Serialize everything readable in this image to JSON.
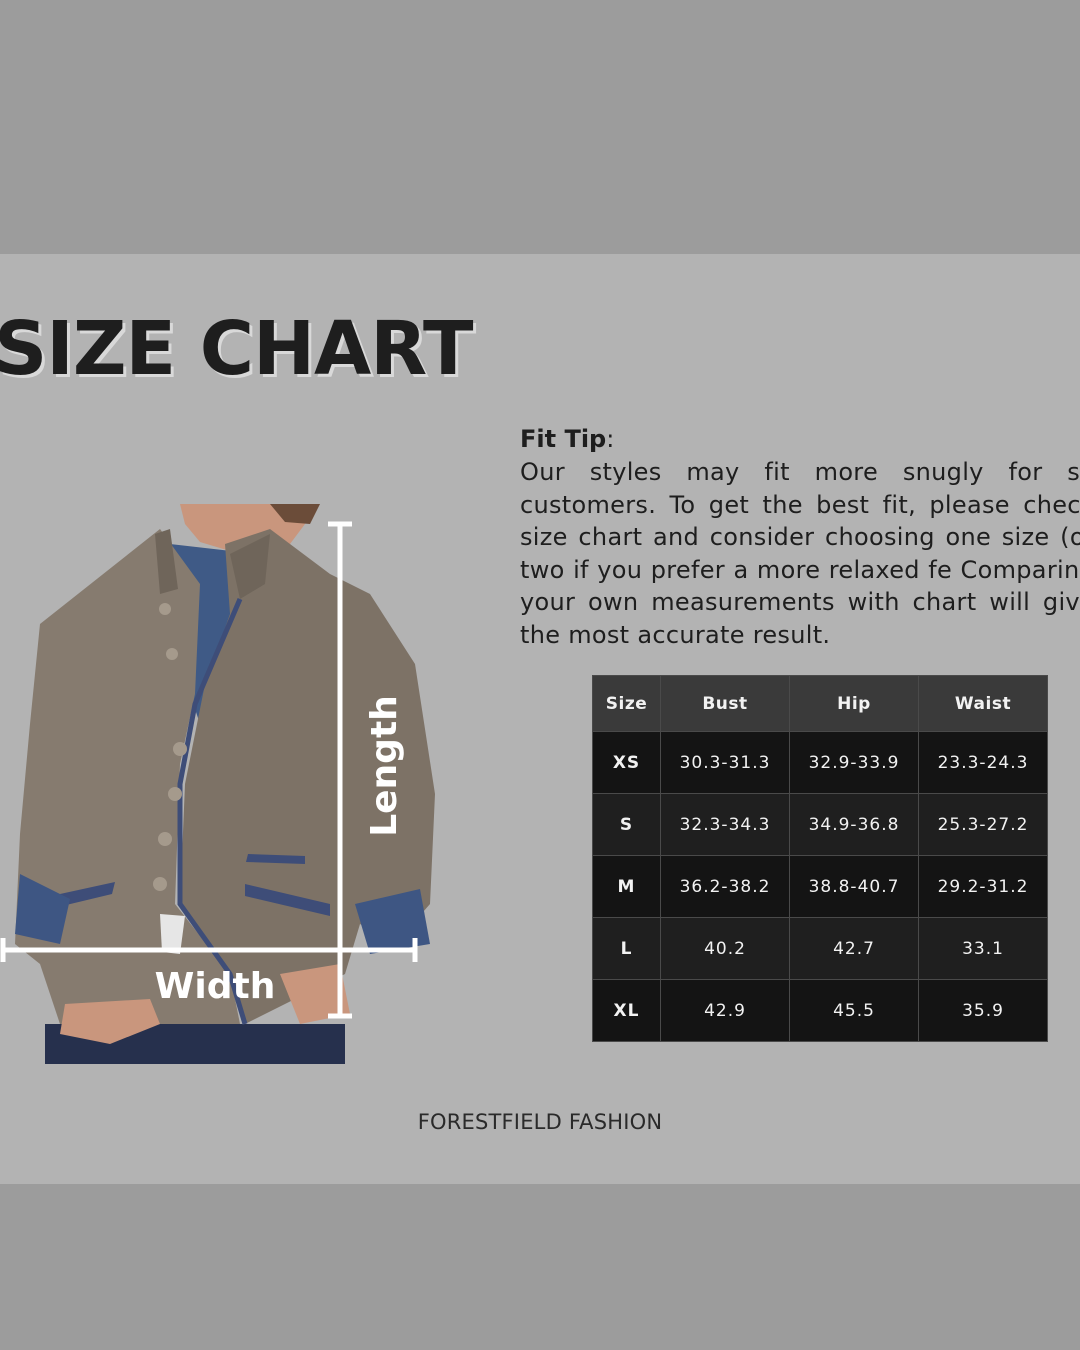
{
  "title": "SIZE CHART",
  "fit_tip": {
    "heading": "Fit Tip",
    "colon": ":",
    "body": "Our styles may fit more snugly for so customers. To get the best fit, please check size chart and consider choosing one size (or two if you prefer a more relaxed fe Comparing your own measurements with chart will give the most accurate result."
  },
  "measure_labels": {
    "length": "Length",
    "width": "Width"
  },
  "table": {
    "headers": [
      "Size",
      "Bust",
      "Hip",
      "Waist"
    ],
    "rows": [
      [
        "XS",
        "30.3-31.3",
        "32.9-33.9",
        "23.3-24.3"
      ],
      [
        "S",
        "32.3-34.3",
        "34.9-36.8",
        "25.3-27.2"
      ],
      [
        "M",
        "36.2-38.2",
        "38.8-40.7",
        "29.2-31.2"
      ],
      [
        "L",
        "40.2",
        "42.7",
        "33.1"
      ],
      [
        "XL",
        "42.9",
        "45.5",
        "35.9"
      ]
    ]
  },
  "brand": "FORESTFIELD FASHION",
  "colors": {
    "outer_background": "#9c9c9c",
    "card_background": "#b3b3b3",
    "title_text": "#1e1e1e",
    "table_header": "#3a3a3a",
    "table_body": "#1a1a1a",
    "jacket": "#857a6e",
    "trim": "#3e4d78"
  }
}
